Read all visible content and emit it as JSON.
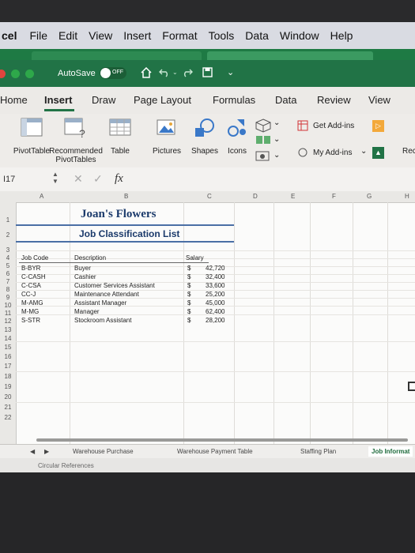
{
  "menubar": {
    "app_name": "cel",
    "items": [
      "File",
      "Edit",
      "View",
      "Insert",
      "Format",
      "Tools",
      "Data",
      "Window",
      "Help"
    ]
  },
  "titlebar": {
    "autosave": "AutoSave",
    "toggle": "OFF"
  },
  "ribbon_tabs": [
    "Home",
    "Insert",
    "Draw",
    "Page Layout",
    "Formulas",
    "Data",
    "Review",
    "View"
  ],
  "ribbon": {
    "pivot_table": "PivotTable",
    "recommended_1": "Recommended",
    "recommended_2": "PivotTables",
    "table": "Table",
    "pictures": "Pictures",
    "shapes": "Shapes",
    "icons": "Icons",
    "get_addins": "Get Add-ins",
    "my_addins": "My Add-ins",
    "rec": "Rec"
  },
  "formula_bar": {
    "name_box": "I17",
    "fx": "fx"
  },
  "columns": [
    "A",
    "B",
    "C",
    "D",
    "E",
    "F",
    "G",
    "H"
  ],
  "rows": [
    "1",
    "2",
    "3",
    "4",
    "5",
    "6",
    "7",
    "8",
    "9",
    "10",
    "11",
    "12",
    "13",
    "14",
    "15",
    "16",
    "17",
    "18",
    "19",
    "20",
    "21",
    "22"
  ],
  "sheet": {
    "title": "Joan's Flowers",
    "subtitle": "Job Classification List",
    "headers": {
      "code": "Job Code",
      "desc": "Description",
      "salary": "Salary"
    },
    "records": [
      {
        "code": "B-BYR",
        "desc": "Buyer",
        "cur": "$",
        "salary": "42,720"
      },
      {
        "code": "C-CASH",
        "desc": "Cashier",
        "cur": "$",
        "salary": "32,400"
      },
      {
        "code": "C-CSA",
        "desc": "Customer Services Assistant",
        "cur": "$",
        "salary": "33,600"
      },
      {
        "code": "CC-J",
        "desc": "Maintenance Attendant",
        "cur": "$",
        "salary": "25,200"
      },
      {
        "code": "M-AMG",
        "desc": "Assistant Manager",
        "cur": "$",
        "salary": "45,000"
      },
      {
        "code": "M-MG",
        "desc": "Manager",
        "cur": "$",
        "salary": "62,400"
      },
      {
        "code": "S-STR",
        "desc": "Stockroom Assistant",
        "cur": "$",
        "salary": "28,200"
      }
    ]
  },
  "sheet_tabs": [
    "Warehouse Purchase",
    "Warehouse Payment Table",
    "Staffing Plan",
    "Job Informat"
  ],
  "status": "Circular References",
  "colors": {
    "excel_green": "#217346",
    "ribbon": "#eeece9",
    "menubar": "#d9dbe2"
  }
}
